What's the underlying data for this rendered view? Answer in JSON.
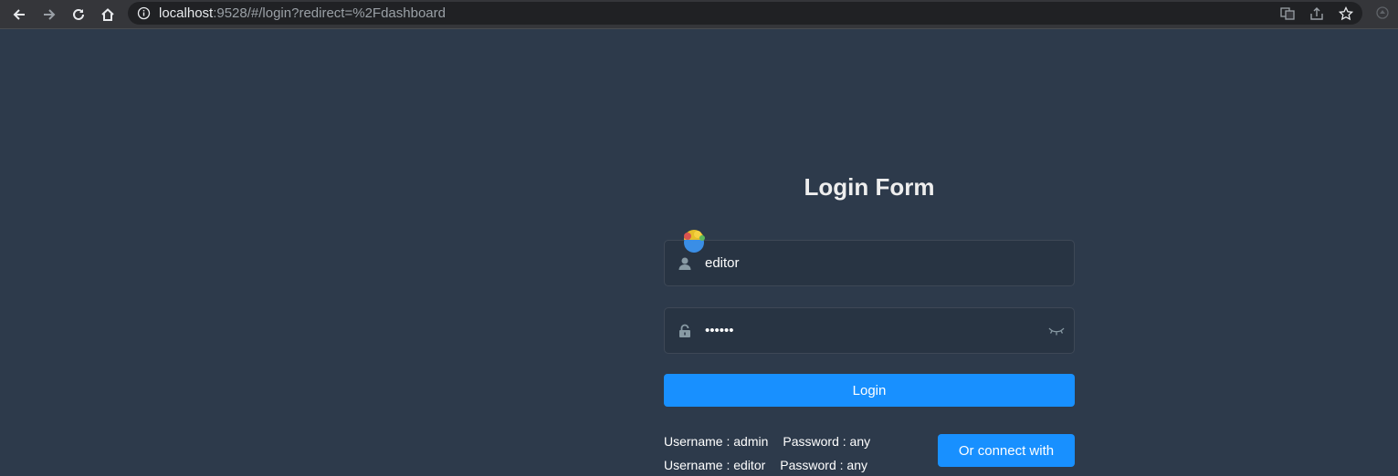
{
  "browser": {
    "url_host": "localhost",
    "url_rest": ":9528/#/login?redirect=%2Fdashboard",
    "icons": [
      "back-icon",
      "forward-icon",
      "reload-icon",
      "home-icon",
      "info-icon",
      "translate-icon",
      "share-icon",
      "bookmark-star-icon",
      "extension-icon"
    ]
  },
  "login": {
    "title": "Login Form",
    "username_value": "editor",
    "password_value": "••••••",
    "login_label": "Login",
    "tips": [
      {
        "username": "Username : admin",
        "password": "Password : any"
      },
      {
        "username": "Username : editor",
        "password": "Password : any"
      }
    ],
    "connect_label": "Or connect with"
  },
  "colors": {
    "background": "#2d3a4b",
    "primary": "#1890ff",
    "title": "#eeeeee"
  }
}
